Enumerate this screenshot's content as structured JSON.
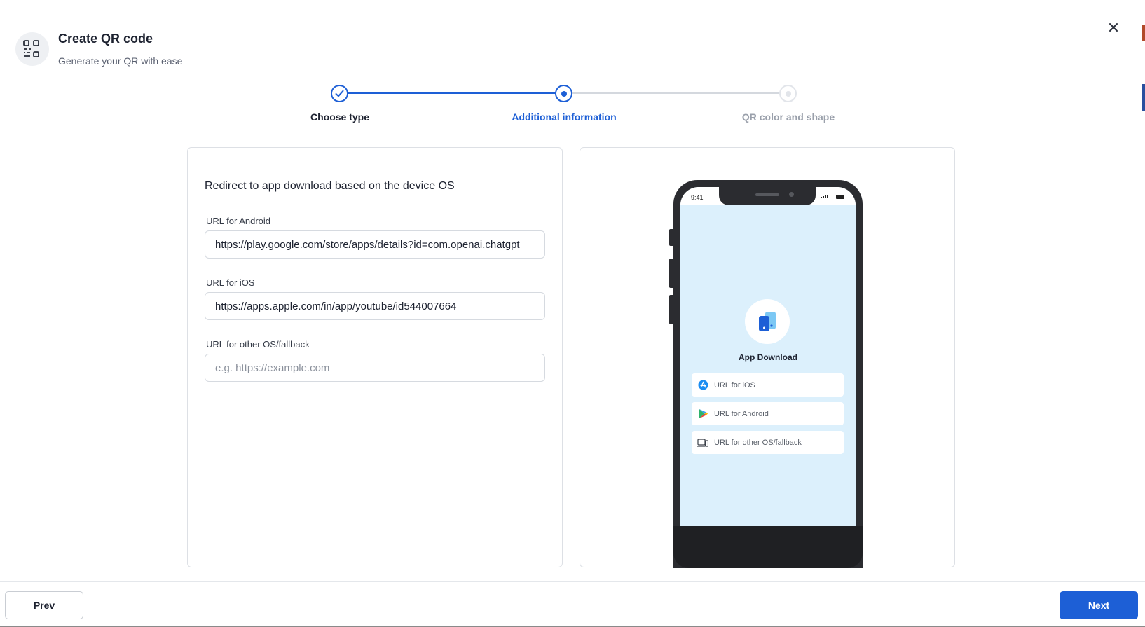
{
  "header": {
    "title": "Create QR code",
    "subtitle": "Generate your QR with ease"
  },
  "stepper": {
    "steps": [
      {
        "label": "Choose type",
        "state": "complete"
      },
      {
        "label": "Additional information",
        "state": "active"
      },
      {
        "label": "QR color and shape",
        "state": "upcoming"
      }
    ]
  },
  "form": {
    "heading": "Redirect to app download based on the device OS",
    "fields": [
      {
        "label": "URL for Android",
        "value": "https://play.google.com/store/apps/details?id=com.openai.chatgpt",
        "placeholder": ""
      },
      {
        "label": "URL for iOS",
        "value": "https://apps.apple.com/in/app/youtube/id544007664",
        "placeholder": ""
      },
      {
        "label": "URL for other OS/fallback",
        "value": "",
        "placeholder": "e.g. https://example.com"
      }
    ]
  },
  "preview": {
    "time": "9:41",
    "app_title": "App Download",
    "links": [
      {
        "label": "URL for iOS",
        "icon": "app-store-icon"
      },
      {
        "label": "URL for Android",
        "icon": "google-play-icon"
      },
      {
        "label": "URL for other OS/fallback",
        "icon": "devices-icon"
      }
    ]
  },
  "footer": {
    "prev_label": "Prev",
    "next_label": "Next"
  },
  "colors": {
    "accent": "#1d5fd6",
    "preview_bg": "#dcf0fc"
  }
}
